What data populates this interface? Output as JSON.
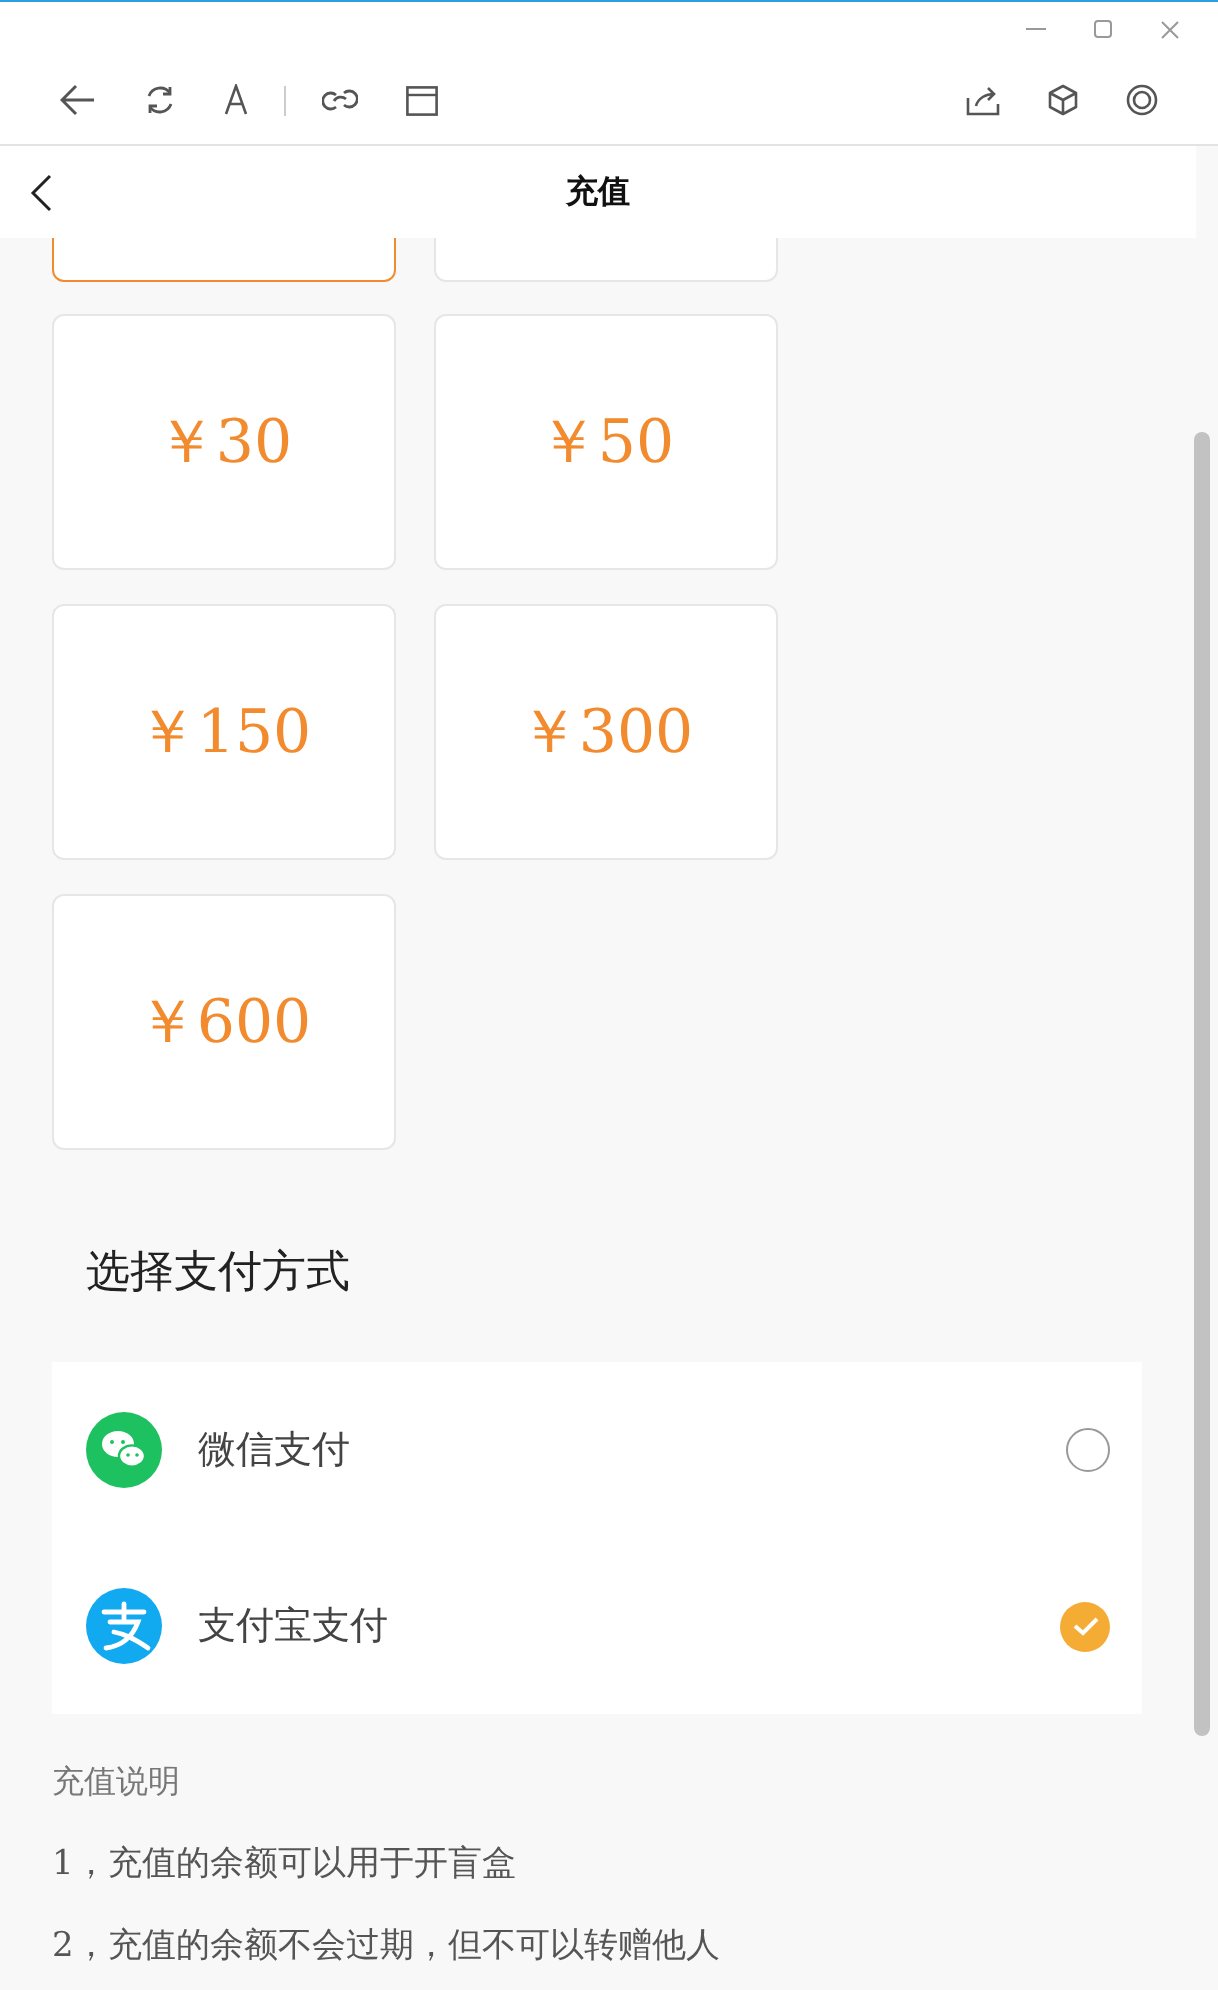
{
  "header": {
    "title": "充值"
  },
  "partial_tiles": [
    {
      "selected": true
    },
    {
      "selected": false
    }
  ],
  "amounts": [
    {
      "amount": "￥30",
      "selected": false
    },
    {
      "amount": "￥50",
      "selected": false
    },
    {
      "amount": "￥150",
      "selected": false
    },
    {
      "amount": "￥300",
      "selected": false
    },
    {
      "amount": "￥600",
      "selected": false
    }
  ],
  "payment": {
    "title": "选择支付方式",
    "methods": [
      {
        "kind": "wechat",
        "label": "微信支付",
        "selected": false
      },
      {
        "kind": "alipay",
        "label": "支付宝支付",
        "selected": true
      }
    ]
  },
  "notes": {
    "title": "充值说明",
    "items": [
      "1，充值的余额可以用于开盲盒",
      "2，充值的余额不会过期，但不可以转赠他人"
    ]
  }
}
